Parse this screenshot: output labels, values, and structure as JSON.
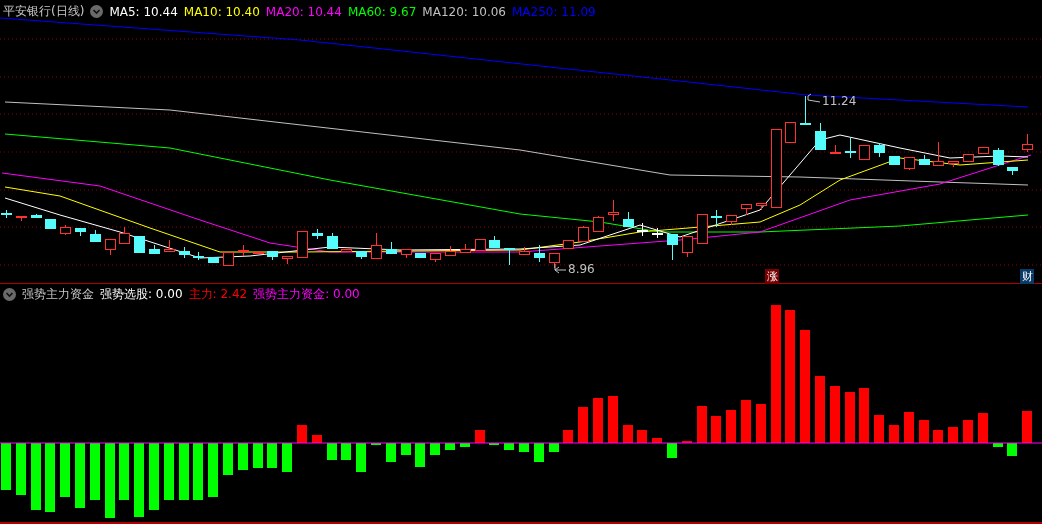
{
  "price_panel": {
    "title": "平安银行(日线)",
    "moving_averages": [
      {
        "text": "MA5: 10.44",
        "color": "#ffffff"
      },
      {
        "text": "MA10: 10.40",
        "color": "#ffff00"
      },
      {
        "text": "MA20: 10.44",
        "color": "#ff00ff"
      },
      {
        "text": "MA60: 9.67",
        "color": "#00ff00"
      },
      {
        "text": "MA120: 10.06",
        "color": "#c0c0c0"
      },
      {
        "text": "MA250: 11.09",
        "color": "#0000ff"
      }
    ],
    "high_label": "11.24",
    "low_label": "8.96",
    "markers": [
      {
        "text": "涨",
        "kind": "rise"
      },
      {
        "text": "财",
        "kind": "finance"
      }
    ]
  },
  "indicator_panel": {
    "title": "强势主力资金",
    "values": [
      {
        "text": "强势选股: 0.00",
        "color": "#ffffff"
      },
      {
        "text": "主力: 2.42",
        "color": "#ff0000"
      },
      {
        "text": "强势主力资金: 0.00",
        "color": "#ff00ff"
      }
    ]
  }
}
